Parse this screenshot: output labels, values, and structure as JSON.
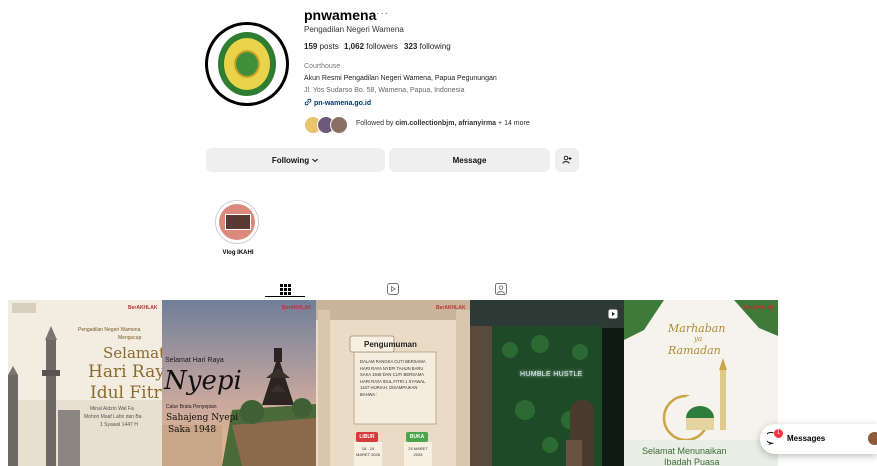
{
  "profile": {
    "username": "pnwamena",
    "more": "···",
    "full_name": "Pengadilan Negeri Wamena",
    "stats": {
      "posts": "159",
      "posts_label": "posts",
      "followers": "1,062",
      "followers_label": "followers",
      "following": "323",
      "following_label": "following"
    },
    "category": "Courthouse",
    "bio_line1": "Akun Resmi Pengadilan Negeri Wamena, Papua Pegunungan",
    "bio_line2": "Jl. Yos Sudarso Bo. 58, Wamena, Papua, Indonesia",
    "link": "pn-wamena.go.id",
    "followed_by_prefix": "Followed by",
    "followed_by_names": "cim.collectionbjm, afrianyirma",
    "followed_by_suffix": "+ 14 more"
  },
  "actions": {
    "following_label": "Following",
    "message_label": "Message"
  },
  "highlights": [
    {
      "label": "Vlog IKAHI"
    }
  ],
  "tabs": [
    {
      "icon": "grid-icon",
      "active": true
    },
    {
      "icon": "reels-icon",
      "active": false
    },
    {
      "icon": "tagged-icon",
      "active": false
    }
  ],
  "posts": [
    {
      "logo": "BerAKHLAK",
      "line1": "Pengadilan Negeri Wamena",
      "line2": "Mengucap",
      "title1": "Selamat",
      "title2": "Hari Raya",
      "title3": "Idul Fitri",
      "sub1": "Minal Aidzin Wal Fa",
      "sub2": "Mohon Maaf Lahir dan Ba",
      "sub3": "1 Syawal 1447 H"
    },
    {
      "logo": "BerAKHLAK",
      "line1": "Selamat Hari Raya",
      "title": "Nyepi",
      "sub1": "Catur Brata Penyepian",
      "sub2": "Sahajeng Nyepi",
      "sub3": "Saka 1948"
    },
    {
      "logo": "BerAKHLAK",
      "title": "Pengumuman",
      "body": "DALAM RANGKA CUTI BERSAMA HARI RAYA NYEPI TAHUN BARU SAKA 1948 DAN CUTI BERSAMA HARI RAYA IDUL FITRI 1 SYAWAL 1447 HIJRIAH, DISAMPAIKAN BAHWA :",
      "libur_label": "LIBUR",
      "libur_date": "18 - 24 MARET 2026",
      "buka_label": "BUKA",
      "buka_date": "25 MARET 2026"
    },
    {
      "neon": "HUMBLE HUSTLE",
      "reel": true
    },
    {
      "logo": "BerAKHLAK",
      "script1": "Marhaban",
      "script2": "ya",
      "script3": "Ramadan",
      "footer1": "Selamat Menunaikan",
      "footer2": "Ibadah Puasa"
    }
  ],
  "messages": {
    "label": "Messages",
    "badge": "1"
  },
  "colors": {
    "link": "#00376b",
    "button_bg": "#efefef",
    "badge": "#ff3040"
  }
}
